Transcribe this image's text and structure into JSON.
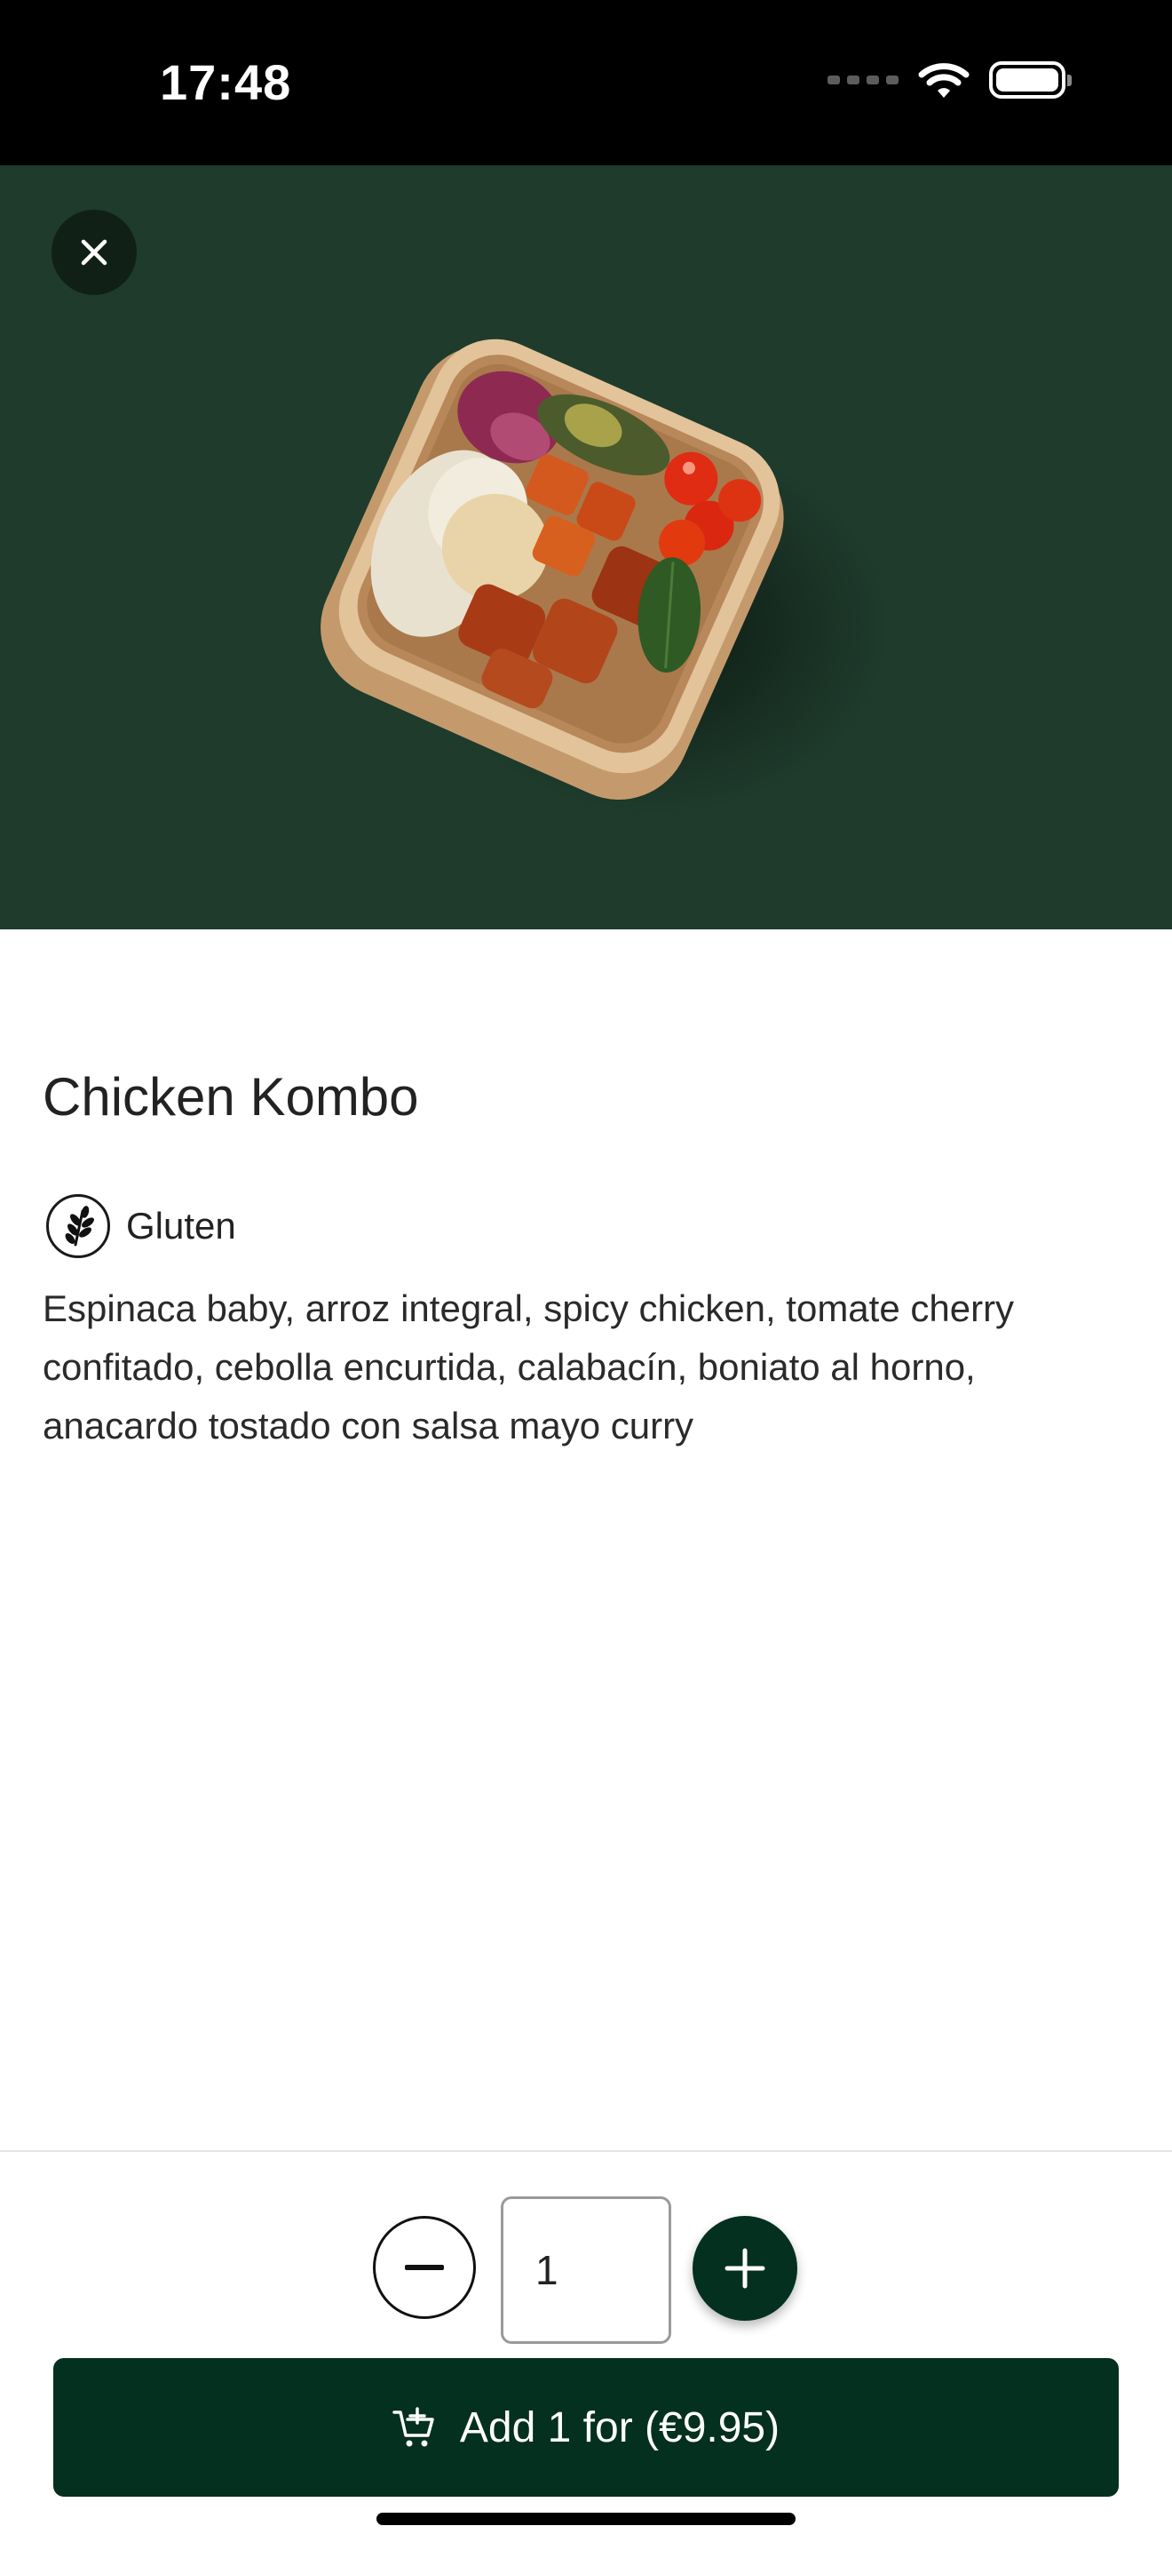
{
  "status_bar": {
    "time": "17:48"
  },
  "product": {
    "title": "Chicken Kombo",
    "allergens": [
      {
        "icon": "wheat-icon",
        "label": "Gluten"
      }
    ],
    "description": "Espinaca baby, arroz integral, spicy chicken, tomate cherry confitado, cebolla encurtida, calabacín, boniato al horno, anacardo tostado con salsa mayo curry"
  },
  "quantity": {
    "value": "1"
  },
  "cart_button": {
    "label": "Add 1 for (€9.95)"
  },
  "colors": {
    "hero_bg": "#1e3b2c",
    "primary": "#03301f",
    "close_bg": "#112017"
  }
}
